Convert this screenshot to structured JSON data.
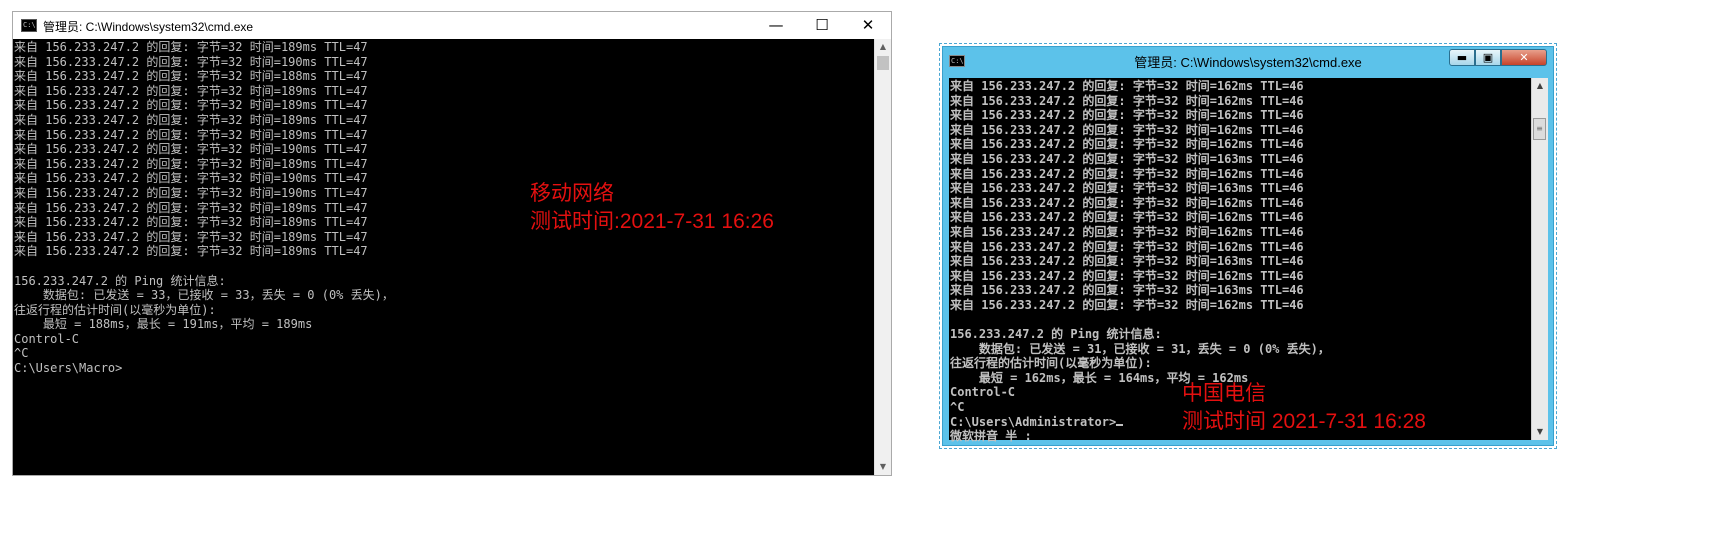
{
  "window1": {
    "title": "管理员: C:\\Windows\\system32\\cmd.exe",
    "icon_text": "C:\\",
    "controls": [
      "—",
      "☐",
      "✕"
    ],
    "lines": [
      "来自 156.233.247.2 的回复: 字节=32 时间=189ms TTL=47",
      "来自 156.233.247.2 的回复: 字节=32 时间=190ms TTL=47",
      "来自 156.233.247.2 的回复: 字节=32 时间=188ms TTL=47",
      "来自 156.233.247.2 的回复: 字节=32 时间=189ms TTL=47",
      "来自 156.233.247.2 的回复: 字节=32 时间=189ms TTL=47",
      "来自 156.233.247.2 的回复: 字节=32 时间=189ms TTL=47",
      "来自 156.233.247.2 的回复: 字节=32 时间=189ms TTL=47",
      "来自 156.233.247.2 的回复: 字节=32 时间=190ms TTL=47",
      "来自 156.233.247.2 的回复: 字节=32 时间=189ms TTL=47",
      "来自 156.233.247.2 的回复: 字节=32 时间=190ms TTL=47",
      "来自 156.233.247.2 的回复: 字节=32 时间=190ms TTL=47",
      "来自 156.233.247.2 的回复: 字节=32 时间=189ms TTL=47",
      "来自 156.233.247.2 的回复: 字节=32 时间=189ms TTL=47",
      "来自 156.233.247.2 的回复: 字节=32 时间=189ms TTL=47",
      "来自 156.233.247.2 的回复: 字节=32 时间=189ms TTL=47",
      "",
      "156.233.247.2 的 Ping 统计信息:",
      "    数据包: 已发送 = 33，已接收 = 33，丢失 = 0 (0% 丢失)，",
      "往返行程的估计时间(以毫秒为单位):",
      "    最短 = 188ms，最长 = 191ms，平均 = 189ms",
      "Control-C",
      "^C",
      "C:\\Users\\Macro>"
    ]
  },
  "window2": {
    "title": "管理员: C:\\Windows\\system32\\cmd.exe",
    "icon_text": "C:\\",
    "controls": [
      "▬",
      "▣",
      "✕"
    ],
    "lines": [
      "来自 156.233.247.2 的回复: 字节=32 时间=162ms TTL=46",
      "来自 156.233.247.2 的回复: 字节=32 时间=162ms TTL=46",
      "来自 156.233.247.2 的回复: 字节=32 时间=162ms TTL=46",
      "来自 156.233.247.2 的回复: 字节=32 时间=162ms TTL=46",
      "来自 156.233.247.2 的回复: 字节=32 时间=162ms TTL=46",
      "来自 156.233.247.2 的回复: 字节=32 时间=163ms TTL=46",
      "来自 156.233.247.2 的回复: 字节=32 时间=162ms TTL=46",
      "来自 156.233.247.2 的回复: 字节=32 时间=163ms TTL=46",
      "来自 156.233.247.2 的回复: 字节=32 时间=162ms TTL=46",
      "来自 156.233.247.2 的回复: 字节=32 时间=162ms TTL=46",
      "来自 156.233.247.2 的回复: 字节=32 时间=162ms TTL=46",
      "来自 156.233.247.2 的回复: 字节=32 时间=162ms TTL=46",
      "来自 156.233.247.2 的回复: 字节=32 时间=163ms TTL=46",
      "来自 156.233.247.2 的回复: 字节=32 时间=162ms TTL=46",
      "来自 156.233.247.2 的回复: 字节=32 时间=163ms TTL=46",
      "来自 156.233.247.2 的回复: 字节=32 时间=162ms TTL=46",
      "",
      "156.233.247.2 的 Ping 统计信息:",
      "    数据包: 已发送 = 31，已接收 = 31，丢失 = 0 (0% 丢失)，",
      "往返行程的估计时间(以毫秒为单位):",
      "    最短 = 162ms，最长 = 164ms，平均 = 162ms",
      "Control-C",
      "^C",
      "C:\\Users\\Administrator>",
      "微软拼音 半 :"
    ]
  },
  "annotations": {
    "mobile_network": "移动网络",
    "mobile_time": "测试时间:2021-7-31 16:26",
    "telecom": "中国电信",
    "telecom_time": "测试时间 2021-7-31 16:28",
    "color": "#e41010"
  }
}
